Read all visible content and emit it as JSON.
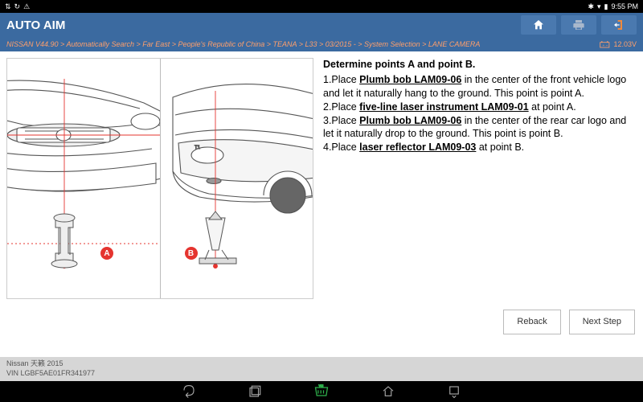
{
  "status_bar": {
    "time": "9:55 PM"
  },
  "header": {
    "title": "AUTO AIM"
  },
  "breadcrumb": "NISSAN V44.90 > Automatically Search > Far East > People's Republic of China > TEANA > L33 > 03/2015 - > System Selection > LANE CAMERA",
  "voltage": "12.03V",
  "diagram": {
    "badgeA": "A",
    "badgeB": "B"
  },
  "instructions": {
    "heading": "Determine points A and point B.",
    "step1_a": "1.Place ",
    "step1_tool": "Plumb bob LAM09-06",
    "step1_b": " in the center of the front vehicle logo and let it naturally hang to the ground. This point is point A.",
    "step2_a": "2.Place ",
    "step2_tool": "five-line laser instrument LAM09-01",
    "step2_b": " at point A.",
    "step3_a": "3.Place ",
    "step3_tool": "Plumb bob LAM09-06",
    "step3_b": " in the center of the rear car logo and let it naturally drop to the ground. This point is point B.",
    "step4_a": "4.Place ",
    "step4_tool": "laser reflector LAM09-03",
    "step4_b": " at point B."
  },
  "buttons": {
    "back": "Reback",
    "next": "Next Step"
  },
  "footer": {
    "line1": "Nissan 天籁 2015",
    "line2": "VIN LGBF5AE01FR341977"
  }
}
